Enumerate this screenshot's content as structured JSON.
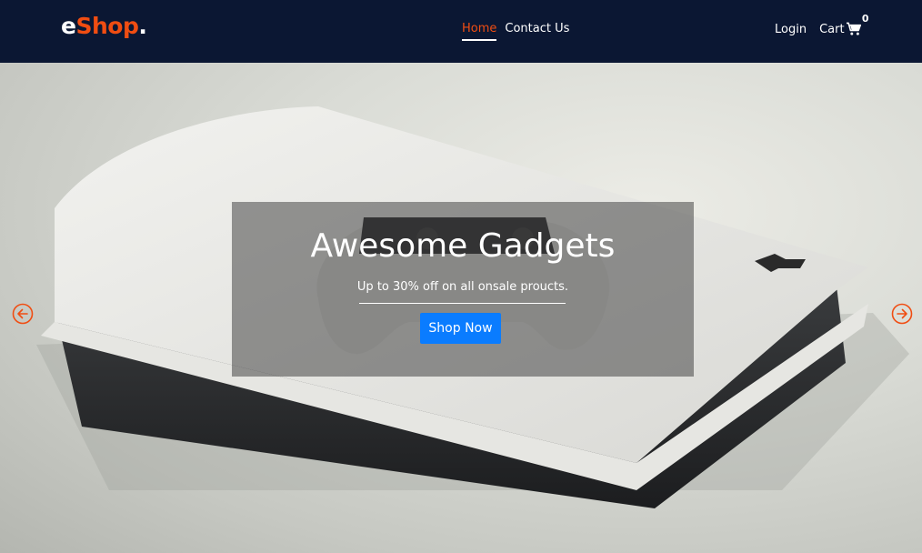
{
  "brand": {
    "part1": "e",
    "part2": "Shop",
    "part3": "."
  },
  "nav": {
    "links": [
      {
        "label": "Home",
        "active": true
      },
      {
        "label": "Contact Us",
        "active": false
      }
    ],
    "login_label": "Login",
    "cart_label": "Cart",
    "cart_count": "0"
  },
  "hero": {
    "title": "Awesome Gadgets",
    "subtitle": "Up to 30% off on all onsale proucts.",
    "cta_label": "Shop Now"
  },
  "icons": {
    "cart": "cart-icon",
    "prev": "arrow-left-circle-icon",
    "next": "arrow-right-circle-icon"
  },
  "colors": {
    "navbar_bg": "#0b1733",
    "accent": "#f04d12",
    "button": "#0a7cff"
  }
}
